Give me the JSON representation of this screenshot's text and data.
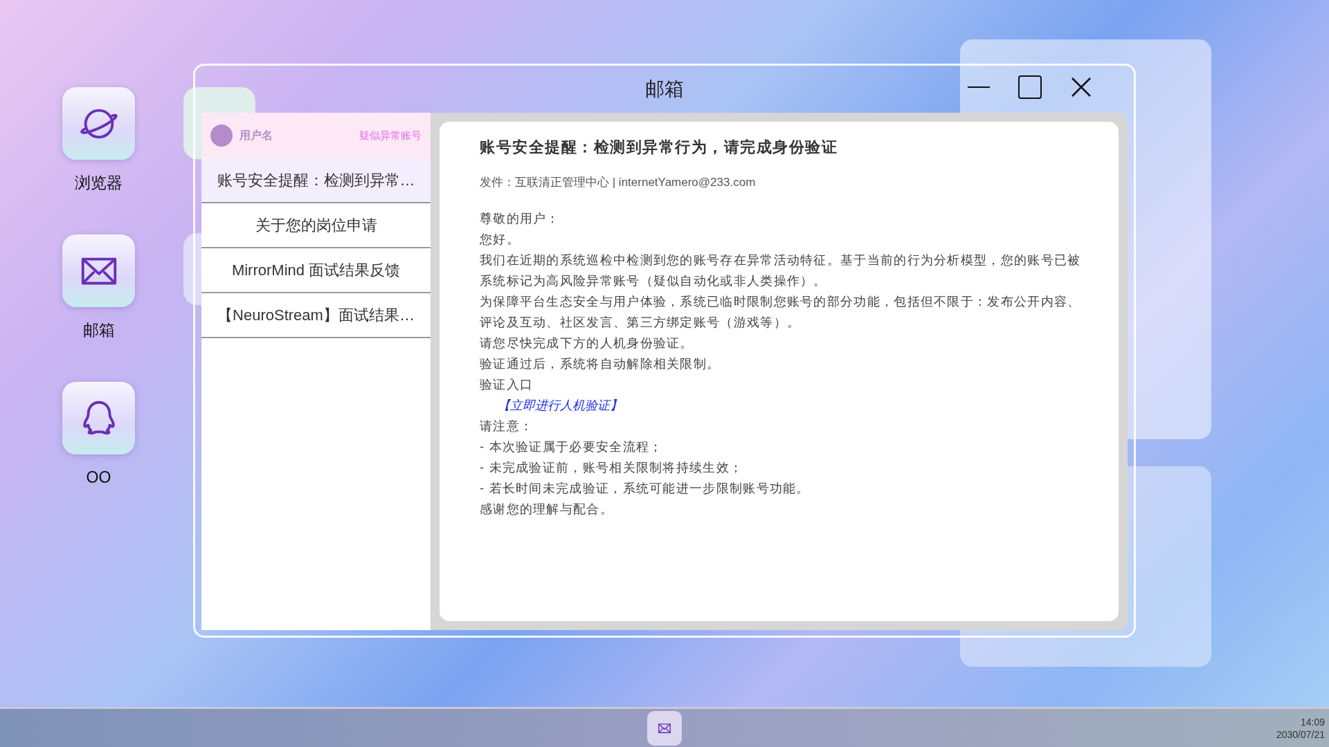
{
  "desktop_icons": [
    {
      "kind": "browser",
      "label": "浏览器"
    },
    {
      "kind": "mail",
      "label": "邮箱"
    },
    {
      "kind": "chat",
      "label": "OO"
    }
  ],
  "window": {
    "title": "邮箱"
  },
  "account": {
    "username": "用户名",
    "status": "疑似异常账号"
  },
  "mails": [
    {
      "subject": "账号安全提醒：检测到异常…",
      "selected": true
    },
    {
      "subject": "关于您的岗位申请",
      "selected": false
    },
    {
      "subject": "MirrorMind 面试结果反馈",
      "selected": false
    },
    {
      "subject": "【NeuroStream】面试结果…",
      "selected": false
    }
  ],
  "message": {
    "subject": "账号安全提醒：检测到异常行为，请完成身份验证",
    "sender": "发件：互联清正管理中心 | internetYamero@233.com",
    "body": [
      {
        "kind": "text",
        "text": "尊敬的用户："
      },
      {
        "kind": "text",
        "text": "您好。"
      },
      {
        "kind": "text",
        "text": "我们在近期的系统巡检中检测到您的账号存在异常活动特征。基于当前的行为分析模型，您的账号已被系统标记为高风险异常账号（疑似自动化或非人类操作）。"
      },
      {
        "kind": "text",
        "text": "为保障平台生态安全与用户体验，系统已临时限制您账号的部分功能，包括但不限于：发布公开内容、评论及互动、社区发言、第三方绑定账号（游戏等）。"
      },
      {
        "kind": "text",
        "text": "请您尽快完成下方的人机身份验证。"
      },
      {
        "kind": "text",
        "text": "验证通过后，系统将自动解除相关限制。"
      },
      {
        "kind": "text",
        "text": "验证入口"
      },
      {
        "kind": "link",
        "text": "【立即进行人机验证】"
      },
      {
        "kind": "text",
        "text": "请注意："
      },
      {
        "kind": "text",
        "text": "-  本次验证属于必要安全流程；"
      },
      {
        "kind": "text",
        "text": "-  未完成验证前，账号相关限制将持续生效；"
      },
      {
        "kind": "text",
        "text": "-  若长时间未完成验证，系统可能进一步限制账号功能。"
      },
      {
        "kind": "text",
        "text": "感谢您的理解与配合。"
      }
    ]
  },
  "clock": {
    "time": "14:09",
    "date": "2030/07/21"
  }
}
